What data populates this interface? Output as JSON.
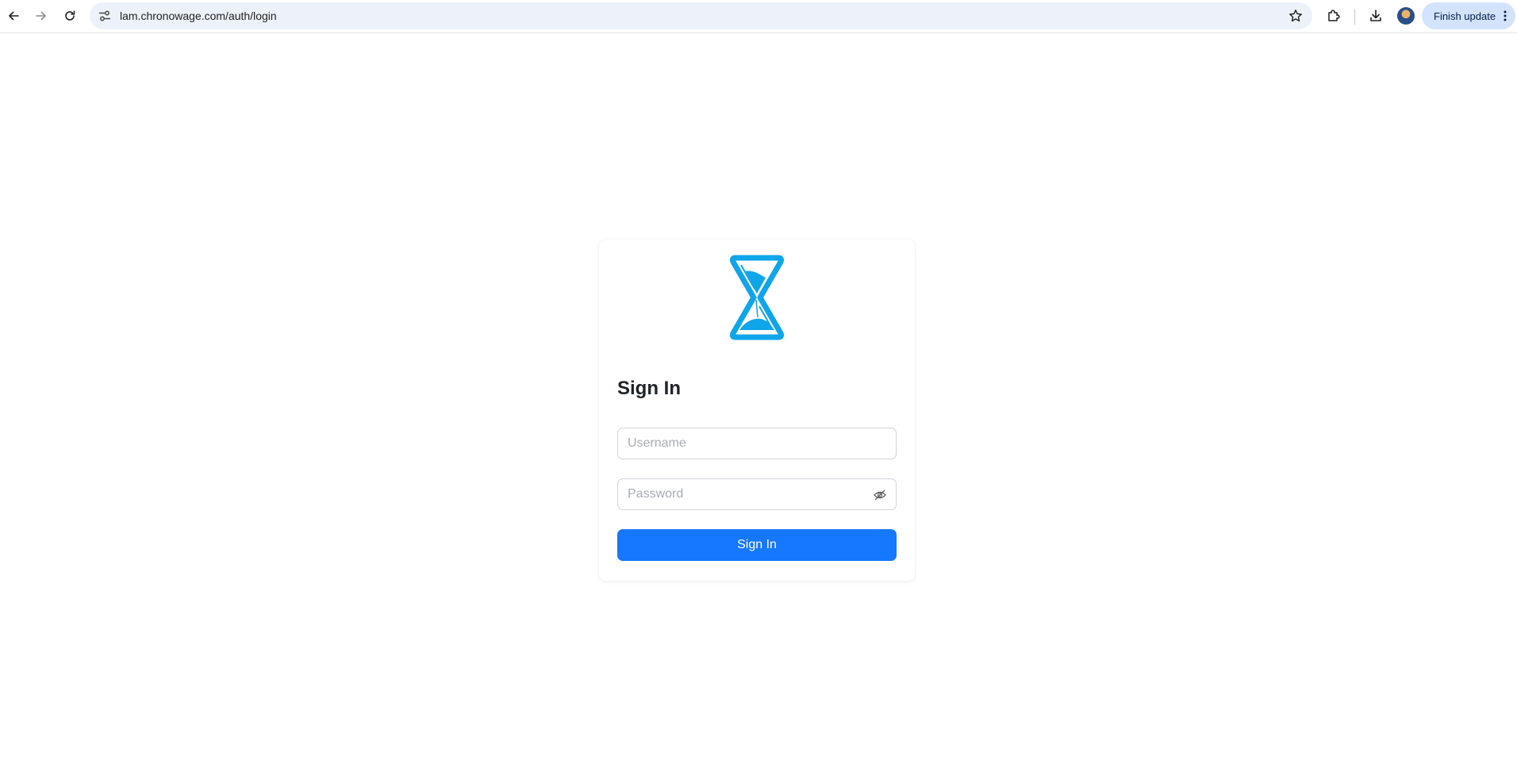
{
  "browser": {
    "url": "lam.chronowage.com/auth/login",
    "finish_update_label": "Finish update",
    "icons": {
      "back": "arrow-left-icon",
      "forward": "arrow-right-icon",
      "reload": "reload-icon",
      "site_info": "tune-icon",
      "bookmark": "star-icon",
      "extensions": "puzzle-icon",
      "downloads": "download-icon",
      "profile": "avatar",
      "menu": "kebab-menu-icon"
    }
  },
  "login": {
    "logo": "hourglass-logo",
    "title": "Sign In",
    "username_placeholder": "Username",
    "username_value": "",
    "password_placeholder": "Password",
    "password_value": "",
    "toggle_visibility_icon": "eye-off-icon",
    "submit_label": "Sign In"
  },
  "colors": {
    "primary": "#1677ff",
    "logo": "#0ea5e9",
    "title": "#1f2329",
    "omnibox": "#edf2fa",
    "finish_update_bg": "#d3e3fd"
  }
}
